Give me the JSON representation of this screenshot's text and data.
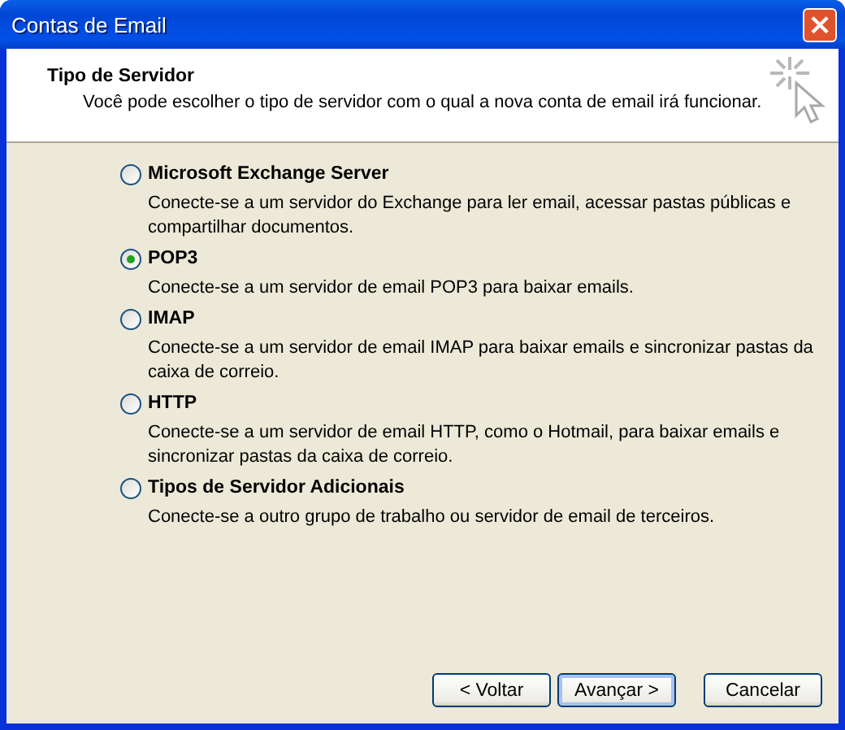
{
  "window": {
    "title": "Contas de Email",
    "close": "×"
  },
  "header": {
    "title": "Tipo de Servidor",
    "subtitle": "Você pode escolher o tipo de servidor com o qual a nova conta de email irá funcionar."
  },
  "options": [
    {
      "label": "Microsoft Exchange Server",
      "description": "Conecte-se a um servidor do Exchange para ler email, acessar pastas públicas e compartilhar documentos.",
      "selected": false
    },
    {
      "label": "POP3",
      "description": "Conecte-se a um servidor de email POP3 para baixar emails.",
      "selected": true
    },
    {
      "label": "IMAP",
      "description": "Conecte-se a um servidor de email IMAP para baixar emails e sincronizar pastas da caixa de correio.",
      "selected": false
    },
    {
      "label": "HTTP",
      "description": "Conecte-se a um servidor de email HTTP, como o Hotmail, para baixar emails e sincronizar pastas da caixa de correio.",
      "selected": false
    },
    {
      "label": "Tipos de Servidor Adicionais",
      "description": "Conecte-se a outro grupo de trabalho ou servidor de email de terceiros.",
      "selected": false
    }
  ],
  "buttons": [
    {
      "label": "< Voltar",
      "default": false
    },
    {
      "label": "Avançar >",
      "default": true
    },
    {
      "label": "Cancelar",
      "default": false
    }
  ]
}
